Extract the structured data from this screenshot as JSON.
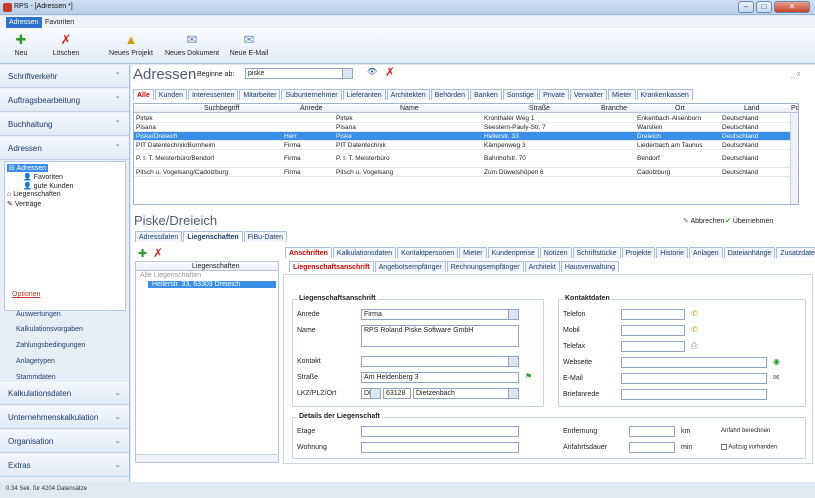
{
  "window": {
    "title": "RPS - [Adressen *]"
  },
  "menu": {
    "tabs": [
      "Adressen",
      "Favoriten"
    ]
  },
  "ribbon": {
    "buttons": [
      {
        "label": "Neu",
        "icon": "plus-icon"
      },
      {
        "label": "Löschen",
        "icon": "delete-x-icon"
      },
      {
        "label": "Neues Projekt",
        "icon": "construction-icon"
      },
      {
        "label": "Neues Dokument",
        "icon": "document-icon"
      },
      {
        "label": "Neue E-Mail",
        "icon": "email-icon"
      }
    ]
  },
  "nav": {
    "sections": [
      "Schriftverkehr",
      "Auftragsbearbeitung",
      "Buchhaltung",
      "Adressen"
    ],
    "bottom_sections": [
      "Kalkulationsdaten",
      "Unternehmenskalkulation",
      "Organisation",
      "Extras"
    ],
    "tree": [
      "Adressen",
      "Favoriten",
      "gute Kunden",
      "Liegenschaften",
      "Verträge"
    ],
    "options_title": "Optionen",
    "options": [
      "Auswertungen",
      "Kalkulationsvorgaben",
      "Zahlungsbedingungen",
      "Anlagetypen",
      "Stammdaten"
    ],
    "status": "0.34 Sek. für 4204 Datensätze"
  },
  "main": {
    "title": "Adressen",
    "filter_label": "Beginne ab:",
    "filter_value": "piske",
    "close_label": "_ x"
  },
  "categories": [
    "Alle",
    "Kunden",
    "Interessenten",
    "Mitarbeiter",
    "Subunternehmer",
    "Lieferanten",
    "Architekten",
    "Behörden",
    "Banken",
    "Sonstige",
    "Private",
    "Verwalter",
    "Mieter",
    "Krankenkassen"
  ],
  "grid": {
    "columns": [
      "Suchbegriff",
      "Anrede",
      "Name",
      "Straße",
      "Branche",
      "Ort",
      "Land",
      "Po"
    ],
    "rows": [
      [
        "Pirtek",
        "",
        "Pirtek",
        "Kronthaler Weg 1",
        "",
        "Enkenbach-Alsenborn",
        "Deutschland"
      ],
      [
        "Pisana",
        "",
        "Pisana",
        "Seestern-Pauly-Str. 7",
        "",
        "Warstein",
        "Deutschland"
      ],
      [
        "Piske/Dreieich",
        "Herr",
        "Piske",
        "Hellerstr. 33",
        "",
        "Dreieich",
        "Deutschland"
      ],
      [
        "PIT Datentechnik/Bornheim",
        "Firma",
        "PIT Datentechnik",
        "Kämpenweg 3",
        "",
        "Liederbach am Taunus",
        "Deutschland"
      ],
      [
        "P. I. T. Meisterbüro/Bendorf",
        "Firma",
        "P. I. T. Meisterbüro",
        "Bahnhofstr. 70",
        "",
        "Bendorf",
        "Deutschland"
      ],
      [
        "Pitsch u. Vogelsang/Cadolzburg",
        "Firma",
        "Pitsch u. Vogelsang",
        "Zum Düwelshöpen 6",
        "",
        "Cadolzburg",
        "Deutschland"
      ]
    ]
  },
  "detail": {
    "title": "Piske/Dreieich",
    "cancel": "Abbrechen",
    "apply": "Übernehmen",
    "tabs": [
      "Adressdaten",
      "Liegenschaften",
      "FiBu-Daten"
    ],
    "tree_header": "Liegenschaften",
    "tree_root": "Alle Liegenschaften",
    "tree_item": "Hellerstr. 33, 63303 Dreieich",
    "subtabs": [
      "Anschriften",
      "Kalkulationsdaten",
      "Kontaktpersonen",
      "Mieter",
      "Kundenpreise",
      "Notizen",
      "Schriftstücke",
      "Projekte",
      "Historie",
      "Anlagen",
      "Dateianhänge",
      "Zusatzdaten"
    ],
    "subtabs2": [
      "Liegenschaftsanschrift",
      "Angebotsempfänger",
      "Rechnungsempfänger",
      "Architekt",
      "Hausverwaltung"
    ],
    "addr": {
      "title": "Liegenschaftsanschrift",
      "anrede_label": "Anrede",
      "anrede": "Firma",
      "name_label": "Name",
      "name": "RPS Roland Piske Software GmbH",
      "kontakt_label": "Kontakt",
      "strasse_label": "Straße",
      "strasse": "Am Heldenberg 3",
      "lkz_label": "LKZ/PLZ/Ort",
      "lkz": "DE",
      "plz": "63128",
      "ort": "Dietzenbach"
    },
    "kontakt": {
      "title": "Kontaktdaten",
      "labels": [
        "Telefon",
        "Mobil",
        "Telefax",
        "Webseite",
        "E-Mail",
        "Briefanrede"
      ]
    },
    "details": {
      "title": "Details der Liegenschaft",
      "etage": "Etage",
      "wohnung": "Wohnung",
      "entfernung": "Entfernung",
      "km": "km",
      "dauer": "Anfahrtsdauer",
      "min": "min",
      "route": "Anfahrt berechnen",
      "aufzug": "Aufzug vorhanden"
    }
  }
}
